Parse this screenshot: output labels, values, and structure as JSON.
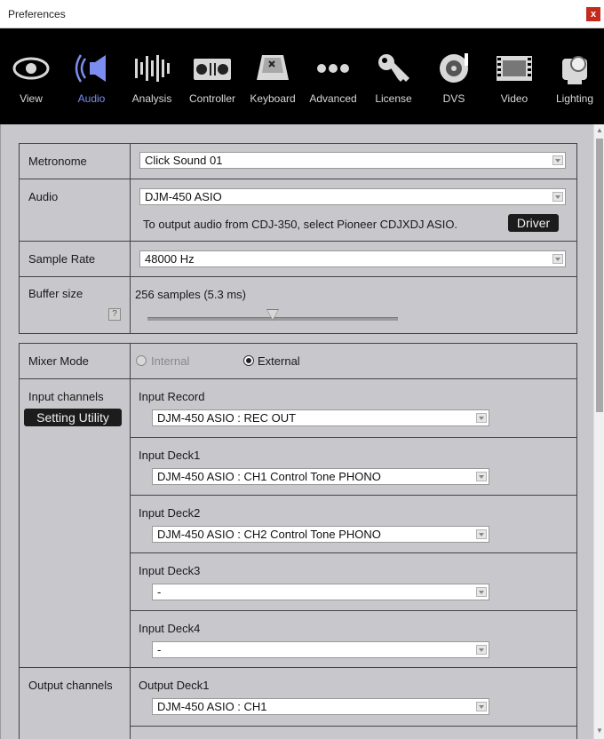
{
  "window": {
    "title": "Preferences",
    "close_label": "x"
  },
  "toolbar": {
    "tabs": [
      {
        "label": "View",
        "icon": "eye-icon",
        "active": false
      },
      {
        "label": "Audio",
        "icon": "speaker-icon",
        "active": true
      },
      {
        "label": "Analysis",
        "icon": "waveform-icon",
        "active": false
      },
      {
        "label": "Controller",
        "icon": "controller-icon",
        "active": false
      },
      {
        "label": "Keyboard",
        "icon": "keyboard-key-icon",
        "active": false
      },
      {
        "label": "Advanced",
        "icon": "dots-icon",
        "active": false
      },
      {
        "label": "License",
        "icon": "key-icon",
        "active": false
      },
      {
        "label": "DVS",
        "icon": "turntable-icon",
        "active": false
      },
      {
        "label": "Video",
        "icon": "film-icon",
        "active": false
      },
      {
        "label": "Lighting",
        "icon": "moving-head-light-icon",
        "active": false
      }
    ],
    "active_color": "#7b8df0"
  },
  "audio_settings": {
    "metronome": {
      "label": "Metronome",
      "value": "Click Sound 01"
    },
    "audio": {
      "label": "Audio",
      "value": "DJM-450 ASIO",
      "hint": "To output audio from CDJ-350, select Pioneer CDJXDJ ASIO.",
      "driver_button": "Driver"
    },
    "sample_rate": {
      "label": "Sample Rate",
      "value": "48000 Hz"
    },
    "buffer_size": {
      "label": "Buffer size",
      "value_text": "256 samples (5.3 ms)",
      "help": "?",
      "slider_fraction": 0.5
    }
  },
  "mixer": {
    "mode": {
      "label": "Mixer Mode",
      "options": [
        {
          "label": "Internal",
          "selected": false,
          "enabled": false
        },
        {
          "label": "External",
          "selected": true,
          "enabled": true
        }
      ]
    },
    "input_channels": {
      "label": "Input channels",
      "setting_utility": "Setting Utility",
      "items": [
        {
          "label": "Input Record",
          "value": "DJM-450 ASIO : REC OUT"
        },
        {
          "label": "Input Deck1",
          "value": "DJM-450 ASIO : CH1 Control Tone PHONO"
        },
        {
          "label": "Input Deck2",
          "value": "DJM-450 ASIO : CH2 Control Tone PHONO"
        },
        {
          "label": "Input Deck3",
          "value": "-"
        },
        {
          "label": "Input Deck4",
          "value": "-"
        }
      ]
    },
    "output_channels": {
      "label": "Output channels",
      "items": [
        {
          "label": "Output Deck1",
          "value": "DJM-450 ASIO : CH1"
        }
      ]
    }
  }
}
